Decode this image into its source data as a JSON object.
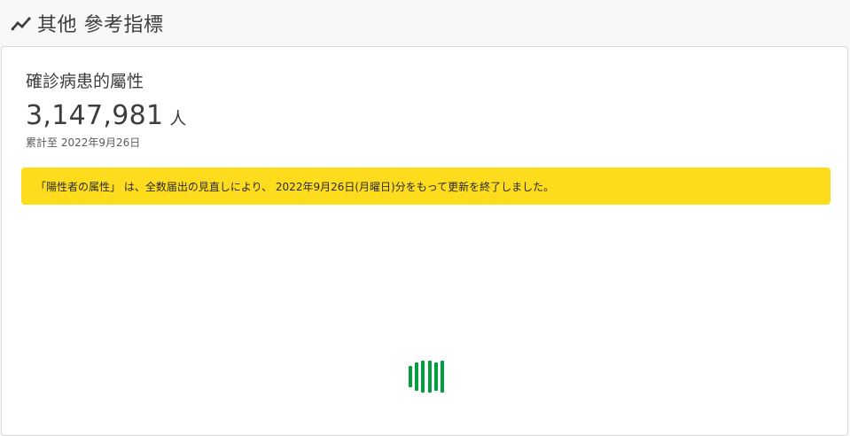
{
  "section": {
    "title": "其他 參考指標",
    "icon": "trend-line-icon"
  },
  "card": {
    "title": "確診病患的屬性",
    "value": "3,147,981",
    "unit": "人",
    "date_note": "累計至 2022年9月26日",
    "notice": "「陽性者の属性」 は、全数届出の見直しにより、 2022年9月26日(月曜日)分をもって更新を終了しました。"
  },
  "loader": {
    "color": "#00a040",
    "icon": "loading-bars-icon"
  },
  "colors": {
    "notice_background": "#fddb1d",
    "accent_green": "#00a040",
    "text": "#3d3d3d"
  }
}
